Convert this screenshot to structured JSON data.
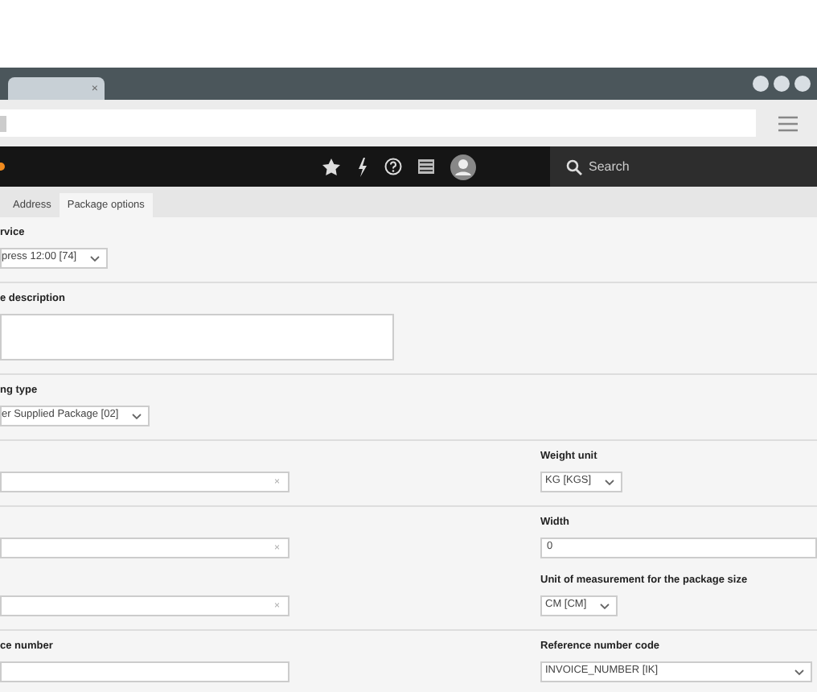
{
  "browser": {
    "tab_close": "×"
  },
  "app_header": {
    "search_placeholder": "Search"
  },
  "tabs": [
    {
      "label": "Address",
      "selected": false
    },
    {
      "label": "Package options",
      "selected": true
    }
  ],
  "sections": [
    {
      "rows": [
        {
          "left": {
            "label": "rvice",
            "kind": "select",
            "value": "press 12:00 [74]"
          }
        }
      ]
    },
    {
      "rows": [
        {
          "left": {
            "label": "e description",
            "kind": "textarea"
          }
        }
      ]
    },
    {
      "rows": [
        {
          "left": {
            "label": "ng type",
            "kind": "select",
            "value": "er Supplied Package [02]"
          }
        }
      ]
    },
    {
      "rows": [
        {
          "left": {
            "kind": "clearable",
            "clear": "×"
          },
          "right": {
            "label": "Weight unit",
            "kind": "select",
            "value": "KG [KGS]"
          }
        }
      ]
    },
    {
      "rows": [
        {
          "left": {
            "kind": "clearable",
            "clear": "×"
          },
          "right": {
            "label": "Width",
            "kind": "input",
            "value": "0"
          }
        },
        {
          "left": {
            "kind": "clearable",
            "clear": "×"
          },
          "right": {
            "label": "Unit of measurement for the package size",
            "kind": "select",
            "value": "CM [CM]"
          }
        }
      ]
    },
    {
      "rows": [
        {
          "left": {
            "label": "ce number",
            "kind": "input"
          },
          "right": {
            "label": "Reference number code",
            "kind": "wide-select",
            "value": "INVOICE_NUMBER [IK]"
          }
        }
      ]
    }
  ]
}
